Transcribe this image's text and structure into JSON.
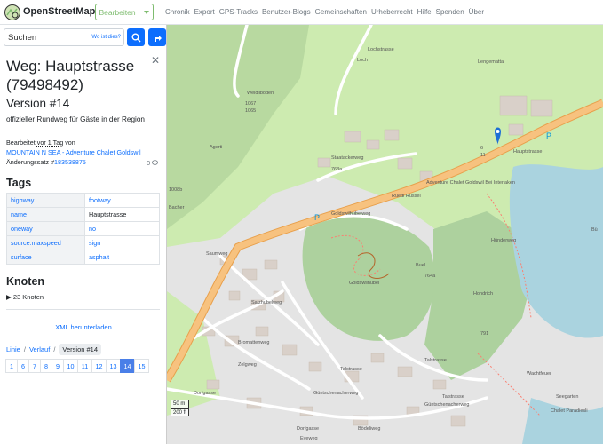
{
  "header": {
    "brand": "OpenStreetMap",
    "edit_label": "Bearbeiten",
    "nav": [
      "Chronik",
      "Export",
      "GPS-Tracks",
      "Benutzer-Blogs",
      "Gemeinschaften",
      "Urheberrecht",
      "Hilfe",
      "Spenden",
      "Über"
    ]
  },
  "search": {
    "placeholder": "Suchen",
    "where_label": "Wo ist dies?"
  },
  "way": {
    "title": "Weg: Hauptstrasse (79498492)",
    "version": "Version #14",
    "comment": "offizieller Rundweg für Gäste in der Region",
    "edited_prefix": "Bearbeitet ",
    "edited_time": "vor 1 Tag",
    "edited_suffix": " von",
    "user": "MOUNTAIN N SEA - Adventure Chalet Goldswil",
    "changeset_prefix": "Änderungssatz #",
    "changeset_id": "183538875",
    "comments_count": "0"
  },
  "tags": {
    "heading": "Tags",
    "rows": [
      {
        "key": "highway",
        "value": "footway",
        "link": true
      },
      {
        "key": "name",
        "value": "Hauptstrasse",
        "link": false
      },
      {
        "key": "oneway",
        "value": "no",
        "link": true
      },
      {
        "key": "source:maxspeed",
        "value": "sign",
        "link": true
      },
      {
        "key": "surface",
        "value": "asphalt",
        "link": true
      }
    ]
  },
  "nodes": {
    "heading": "Knoten",
    "toggle": "23 Knoten"
  },
  "xml_label": "XML herunterladen",
  "breadcrumb": {
    "line": "Linie",
    "history": "Verlauf",
    "current": "Version #14"
  },
  "pager": [
    "1",
    "6",
    "7",
    "8",
    "9",
    "10",
    "11",
    "12",
    "13",
    "14",
    "15"
  ],
  "pager_active": "14",
  "map": {
    "labels": [
      "Lochstrasse",
      "Loch",
      "Lengematta",
      "Weidliboden",
      "Agerti",
      "Staatackerweg",
      "Hauptstrasse",
      "Goldswilhubelweg",
      "Adventure Chalet Goldswil Bei Interlaken",
      "Rüedi Russel",
      "Hünderweg",
      "Buel",
      "Hondrich",
      "Goldswilhubel",
      "Saumweg",
      "Salzhubelweg",
      "Bromattenweg",
      "Zelgweg",
      "Dorfgasse",
      "Dorfgasse",
      "Talstrasse",
      "Talstrasse",
      "Talstrasse",
      "Güntschenacherweg",
      "Güntschenacherweg",
      "Eyeweg",
      "Bödeliweg",
      "Wachtfeuer",
      "Chalet Paradiesli",
      "Seegarten",
      "Bü",
      "Bacher",
      "1067",
      "1065",
      "1008b",
      "763a",
      "764a",
      "791",
      "6",
      "11"
    ],
    "scale_m": "50 m",
    "scale_ft": "200 ft",
    "colors": {
      "accent": "#7ebc6f",
      "link": "#0d6efd",
      "road": "#f7c27f",
      "forest": "#add19e",
      "water": "#aad3df",
      "grass": "#cdebb0"
    }
  }
}
